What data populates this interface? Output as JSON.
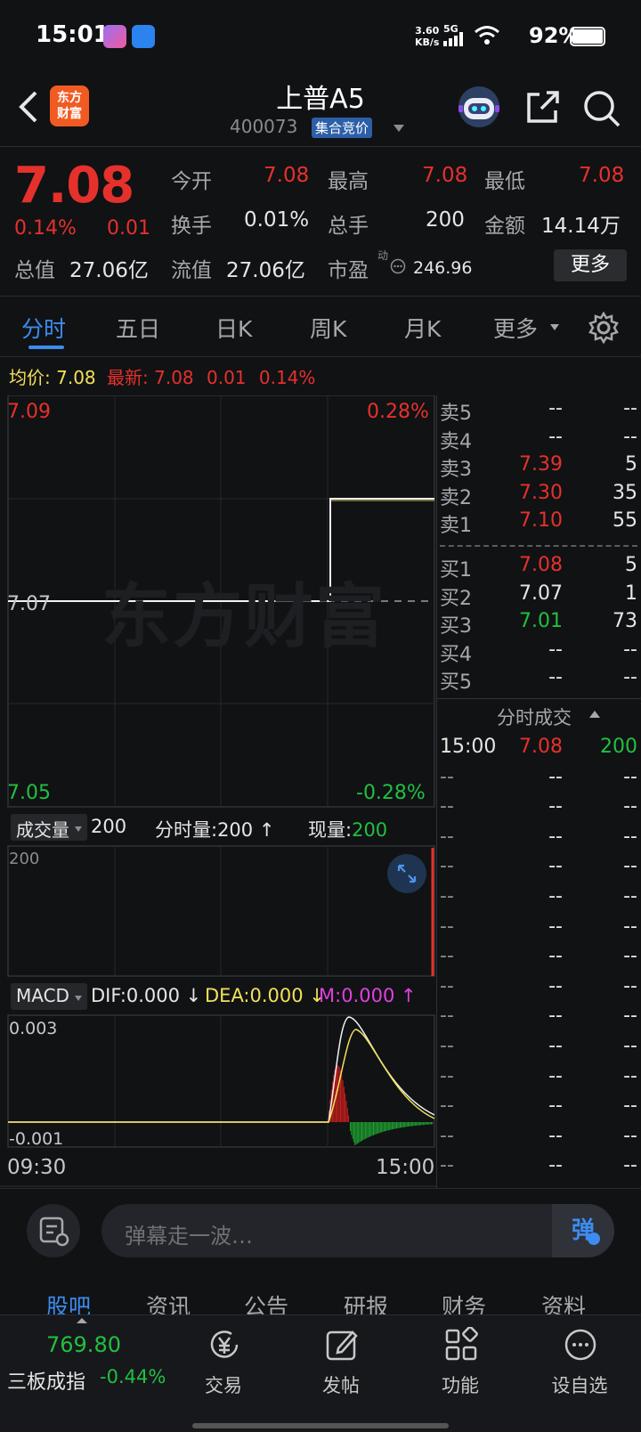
{
  "status_bar": {
    "time": "15:01",
    "net_speed_top": "3.60",
    "net_speed_bottom": "KB/s",
    "net_type": "5G",
    "battery": "92%"
  },
  "header": {
    "logo_line1": "东方",
    "logo_line2": "财富",
    "title": "上普A5",
    "code": "400073",
    "badge": "集合竞价"
  },
  "quote": {
    "price": "7.08",
    "change_pct": "0.14%",
    "change": "0.01",
    "open_label": "今开",
    "open": "7.08",
    "high_label": "最高",
    "high": "7.08",
    "low_label": "最低",
    "low": "7.08",
    "turnover_label": "换手",
    "turnover": "0.01%",
    "volume_label": "总手",
    "volume": "200",
    "amount_label": "金额",
    "amount": "14.14万",
    "mktcap_label": "总值",
    "mktcap": "27.06亿",
    "float_label": "流值",
    "float_cap": "27.06亿",
    "pe_label": "市盈",
    "pe_sup": "动",
    "pe": "246.96",
    "more": "更多"
  },
  "tabs": [
    "分时",
    "五日",
    "日K",
    "周K",
    "月K",
    "更多"
  ],
  "avg_bar": {
    "avg_label": "均价:",
    "avg": "7.08",
    "latest_label": "最新:",
    "latest": "7.08",
    "chg": "0.01",
    "pct": "0.14%"
  },
  "chart": {
    "y_top": "7.09",
    "y_top_pct": "0.28%",
    "y_mid": "7.07",
    "y_bot": "7.05",
    "y_bot_pct": "-0.28%",
    "watermark": "东方财富",
    "vol_label": "成交量",
    "vol_value": "200",
    "fenshi_label": "分时量:200 ↑",
    "xianliang_label": "现量:",
    "xianliang": "200",
    "vol_axis": "200",
    "macd_label": "MACD",
    "dif": "DIF:0.000 ↓",
    "dea": "DEA:0.000 ↓",
    "m": "M:0.000 ↑",
    "macd_top": "0.003",
    "macd_bot": "-0.001",
    "x_start": "09:30",
    "x_end": "15:00"
  },
  "order_book": {
    "sell": [
      {
        "label": "卖5",
        "price": "--",
        "vol": "--"
      },
      {
        "label": "卖4",
        "price": "--",
        "vol": "--"
      },
      {
        "label": "卖3",
        "price": "7.39",
        "vol": "5"
      },
      {
        "label": "卖2",
        "price": "7.30",
        "vol": "35"
      },
      {
        "label": "卖1",
        "price": "7.10",
        "vol": "55"
      }
    ],
    "buy": [
      {
        "label": "买1",
        "price": "7.08",
        "vol": "5"
      },
      {
        "label": "买2",
        "price": "7.07",
        "vol": "1"
      },
      {
        "label": "买3",
        "price": "7.01",
        "vol": "73"
      },
      {
        "label": "买4",
        "price": "--",
        "vol": "--"
      },
      {
        "label": "买5",
        "price": "--",
        "vol": "--"
      }
    ],
    "trades_title": "分时成交",
    "trade_first": {
      "time": "15:00",
      "price": "7.08",
      "vol": "200"
    },
    "placeholder": "--"
  },
  "danmu": {
    "placeholder": "弹幕走一波…",
    "button": "弹"
  },
  "bottom_tabs": [
    "股吧",
    "资讯",
    "公告",
    "研报",
    "财务",
    "资料"
  ],
  "nav": {
    "index_value": "769.80",
    "index_name": "三板成指",
    "index_pct": "-0.44%",
    "items": [
      "交易",
      "发帖",
      "功能",
      "设自选"
    ]
  }
}
